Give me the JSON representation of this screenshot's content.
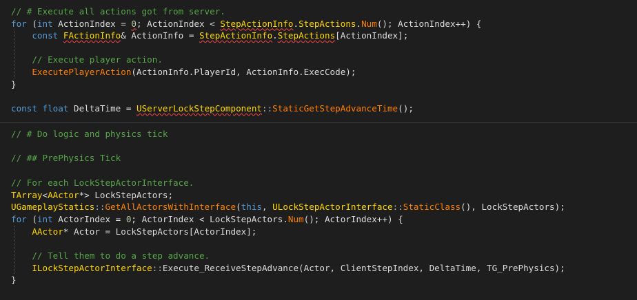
{
  "editor": {
    "top_lines": [
      {
        "tokens": [
          [
            "comment",
            "// # Execute all actions got from server."
          ]
        ]
      },
      {
        "tokens": [
          [
            "kw",
            "for"
          ],
          [
            "txt",
            " ("
          ],
          [
            "kw",
            "int"
          ],
          [
            "txt",
            " ActionIndex = "
          ],
          [
            "num",
            "0"
          ],
          [
            "txt",
            "; ActionIndex < "
          ],
          [
            "tname",
            "StepActionInfo"
          ],
          [
            "txt",
            "."
          ],
          [
            "tname",
            "StepActions"
          ],
          [
            "txt",
            "."
          ],
          [
            "call",
            "Num"
          ],
          [
            "txt",
            "(); ActionIndex++) {"
          ]
        ]
      },
      {
        "tokens": [
          [
            "txt",
            "    "
          ],
          [
            "kw",
            "const"
          ],
          [
            "txt",
            " "
          ],
          [
            "tname",
            "FActionInfo"
          ],
          [
            "txt",
            "& ActionInfo = "
          ],
          [
            "tname",
            "StepActionInfo"
          ],
          [
            "txt",
            "."
          ],
          [
            "tname",
            "StepActions"
          ],
          [
            "txt",
            "[ActionIndex];"
          ]
        ]
      },
      {
        "tokens": [
          [
            "txt",
            ""
          ]
        ]
      },
      {
        "tokens": [
          [
            "txt",
            "    "
          ],
          [
            "comment",
            "// Execute player action."
          ]
        ]
      },
      {
        "tokens": [
          [
            "txt",
            "    "
          ],
          [
            "call",
            "ExecutePlayerAction"
          ],
          [
            "txt",
            "(ActionInfo.PlayerId, ActionInfo.ExecCode);"
          ]
        ]
      },
      {
        "tokens": [
          [
            "txt",
            "}"
          ]
        ]
      },
      {
        "tokens": [
          [
            "txt",
            ""
          ]
        ]
      },
      {
        "tokens": [
          [
            "kw",
            "const"
          ],
          [
            "txt",
            " "
          ],
          [
            "kw",
            "float"
          ],
          [
            "txt",
            " DeltaTime = "
          ],
          [
            "tname",
            "UServerLockStepComponent"
          ],
          [
            "op",
            "::"
          ],
          [
            "call",
            "StaticGetStepAdvanceTime"
          ],
          [
            "txt",
            "();"
          ]
        ]
      }
    ],
    "bottom_lines": [
      {
        "tokens": [
          [
            "comment",
            "// # Do logic and physics tick"
          ]
        ]
      },
      {
        "tokens": [
          [
            "txt",
            ""
          ]
        ]
      },
      {
        "tokens": [
          [
            "comment",
            "// ## PrePhysics Tick"
          ]
        ]
      },
      {
        "tokens": [
          [
            "txt",
            ""
          ]
        ]
      },
      {
        "tokens": [
          [
            "comment",
            "// For each LockStepActorInterface."
          ]
        ]
      },
      {
        "tokens": [
          [
            "tname",
            "TArray"
          ],
          [
            "txt",
            "<"
          ],
          [
            "tname",
            "AActor"
          ],
          [
            "txt",
            "*> LockStepActors;"
          ]
        ]
      },
      {
        "tokens": [
          [
            "tname",
            "UGameplayStatics"
          ],
          [
            "op",
            "::"
          ],
          [
            "call",
            "GetAllActorsWithInterface"
          ],
          [
            "txt",
            "("
          ],
          [
            "kw",
            "this"
          ],
          [
            "txt",
            ", "
          ],
          [
            "tname",
            "ULockStepActorInterface"
          ],
          [
            "op",
            "::"
          ],
          [
            "call",
            "StaticClass"
          ],
          [
            "txt",
            "(), LockStepActors);"
          ]
        ]
      },
      {
        "tokens": [
          [
            "kw",
            "for"
          ],
          [
            "txt",
            " ("
          ],
          [
            "kw",
            "int"
          ],
          [
            "txt",
            " ActorIndex = "
          ],
          [
            "num",
            "0"
          ],
          [
            "txt",
            "; ActorIndex < LockStepActors."
          ],
          [
            "call",
            "Num"
          ],
          [
            "txt",
            "(); ActorIndex++) {"
          ]
        ]
      },
      {
        "tokens": [
          [
            "txt",
            "    "
          ],
          [
            "tname",
            "AActor"
          ],
          [
            "txt",
            "* Actor = LockStepActors[ActorIndex];"
          ]
        ]
      },
      {
        "tokens": [
          [
            "txt",
            ""
          ]
        ]
      },
      {
        "tokens": [
          [
            "txt",
            "    "
          ],
          [
            "comment",
            "// Tell them to do a step advance."
          ]
        ]
      },
      {
        "tokens": [
          [
            "txt",
            "    "
          ],
          [
            "tname",
            "ILockStepActorInterface"
          ],
          [
            "op",
            "::"
          ],
          [
            "txt",
            "Execute_ReceiveStepAdvance(Actor, ClientStepIndex, DeltaTime, TG_PrePhysics);"
          ]
        ]
      },
      {
        "tokens": [
          [
            "txt",
            "}"
          ]
        ]
      }
    ]
  }
}
